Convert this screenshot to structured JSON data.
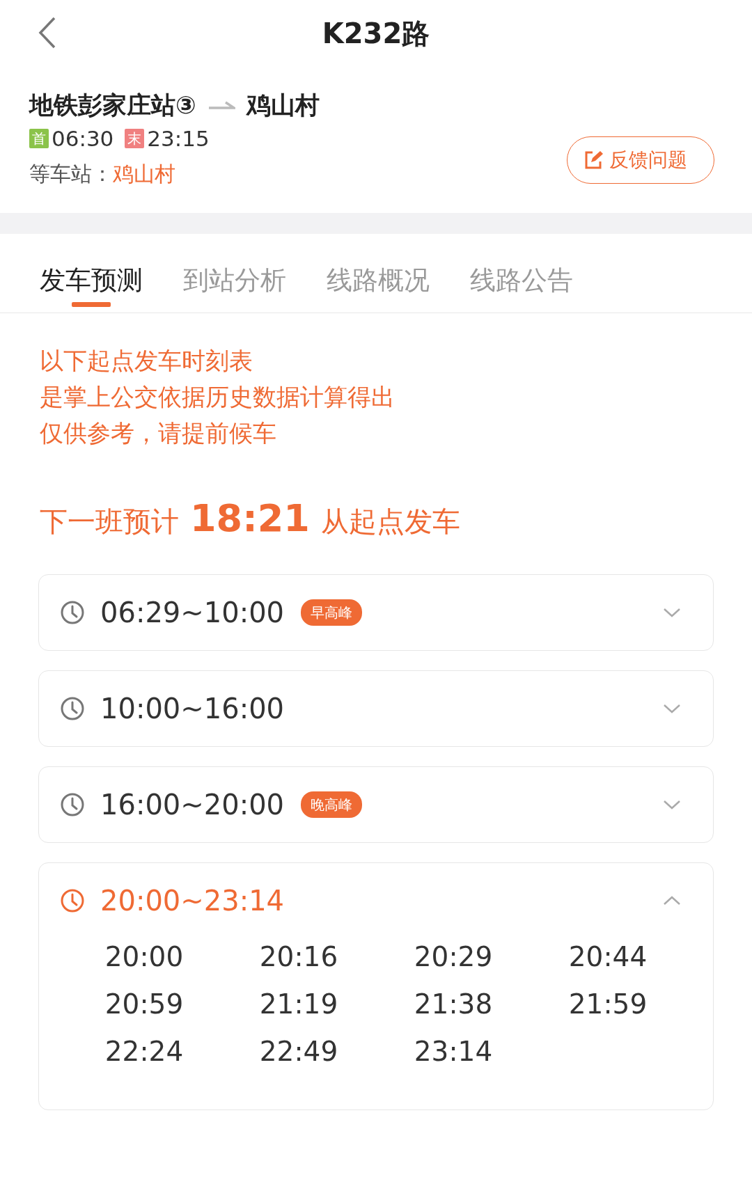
{
  "header": {
    "title": "K232路"
  },
  "route": {
    "from": "地铁彭家庄站③",
    "to": "鸡山村",
    "first_label": "首",
    "first_time": "06:30",
    "last_label": "末",
    "last_time": "23:15",
    "wait_label": "等车站：",
    "wait_station": "鸡山村",
    "feedback": "反馈问题"
  },
  "tabs": [
    {
      "label": "发车预测",
      "selected": true
    },
    {
      "label": "到站分析",
      "selected": false
    },
    {
      "label": "线路概况",
      "selected": false
    },
    {
      "label": "线路公告",
      "selected": false
    }
  ],
  "notice": [
    "以下起点发车时刻表",
    "是掌上公交依据历史数据计算得出",
    "仅供参考，请提前候车"
  ],
  "next_departure": {
    "prefix": "下一班预计",
    "time": "18:21",
    "suffix": "从起点发车"
  },
  "periods": [
    {
      "range": "06:29~10:00",
      "tag": "早高峰",
      "expanded": false
    },
    {
      "range": "10:00~16:00",
      "expanded": false
    },
    {
      "range": "16:00~20:00",
      "tag": "晚高峰",
      "expanded": false
    },
    {
      "range": "20:00~23:14",
      "expanded": true,
      "times": [
        "20:00",
        "20:16",
        "20:29",
        "20:44",
        "20:59",
        "21:19",
        "21:38",
        "21:59",
        "22:24",
        "22:49",
        "23:14"
      ]
    }
  ]
}
